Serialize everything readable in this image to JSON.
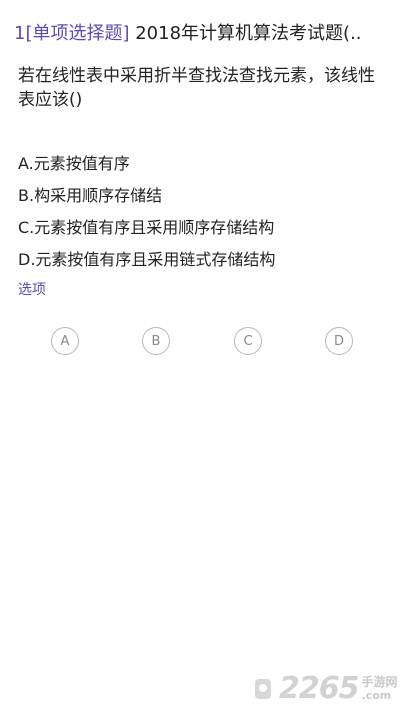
{
  "header": {
    "number_tag": "1[单项选择题]",
    "title": "2018年计算机算法考试题(.."
  },
  "question": {
    "line1": "若在线性表中采用折半查找法查找元素，该线性",
    "line2": "表应该()"
  },
  "options": [
    {
      "label": "A.元素按值有序"
    },
    {
      "label": "B.构采用顺序存储结"
    },
    {
      "label": "C.元素按值有序且采用顺序存储结构"
    },
    {
      "label": "D.元素按值有序且采用链式存储结构"
    }
  ],
  "answer_section": {
    "label": "选项",
    "choices": [
      "A",
      "B",
      "C",
      "D"
    ]
  },
  "watermark": {
    "digits": "2265",
    "cn": "手游网",
    "suffix": ".com"
  },
  "colors": {
    "accent": "#5b4bb7",
    "text": "#222222",
    "choice_border": "#b8b8b8"
  }
}
